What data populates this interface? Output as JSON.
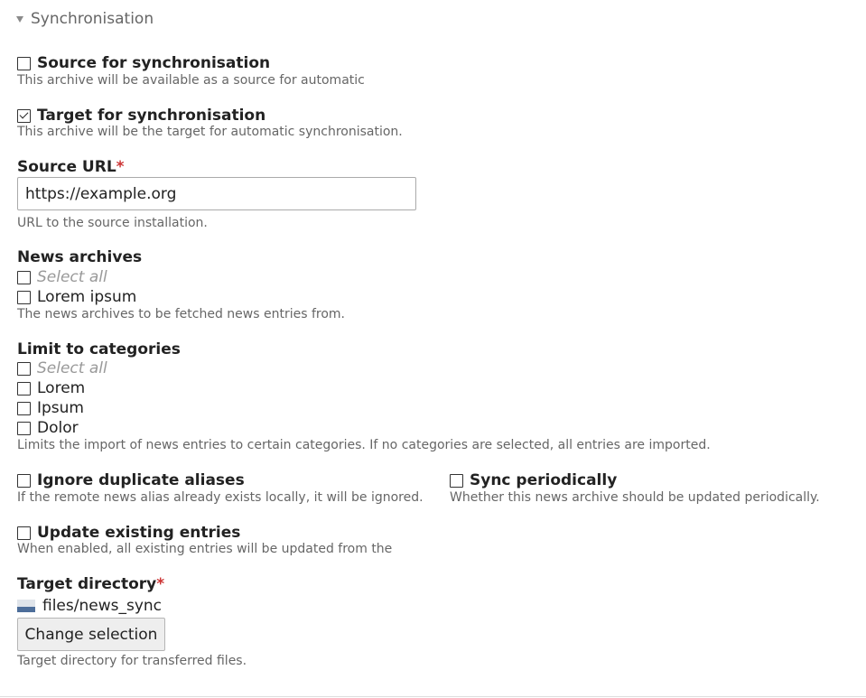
{
  "fieldset": {
    "legend": "Synchronisation"
  },
  "source_sync": {
    "label": "Source for synchronisation",
    "checked": false,
    "help": "This archive will be available as a source for automatic"
  },
  "target_sync": {
    "label": "Target for synchronisation",
    "checked": true,
    "help": "This archive will be the target for automatic synchronisation."
  },
  "source_url": {
    "label": "Source URL",
    "required_mark": "*",
    "value": "https://example.org",
    "help": "URL to the source installation."
  },
  "news_archives": {
    "label": "News archives",
    "select_all": "Select all",
    "options": [
      "Lorem ipsum"
    ],
    "help": "The news archives to be fetched news entries from."
  },
  "categories": {
    "label": "Limit to categories",
    "select_all": "Select all",
    "options": [
      "Lorem",
      "Ipsum",
      "Dolor"
    ],
    "help": "Limits the import of news entries to certain categories. If no categories are selected, all entries are imported."
  },
  "ignore_duplicates": {
    "label": "Ignore duplicate aliases",
    "checked": false,
    "help": "If the remote news alias already exists locally, it will be ignored."
  },
  "sync_periodically": {
    "label": "Sync periodically",
    "checked": false,
    "help": "Whether this news archive should be updated periodically."
  },
  "update_existing": {
    "label": "Update existing entries",
    "checked": false,
    "help": "When enabled, all existing entries will be updated from the"
  },
  "target_directory": {
    "label": "Target directory",
    "required_mark": "*",
    "path": "files/news_sync",
    "folder_icon": "folder-icon",
    "button_label": "Change selection",
    "help": "Target directory for transferred files."
  },
  "colors": {
    "required": "#cc3333",
    "help_text": "#666666",
    "folder_blue": "#4d6e9a"
  }
}
